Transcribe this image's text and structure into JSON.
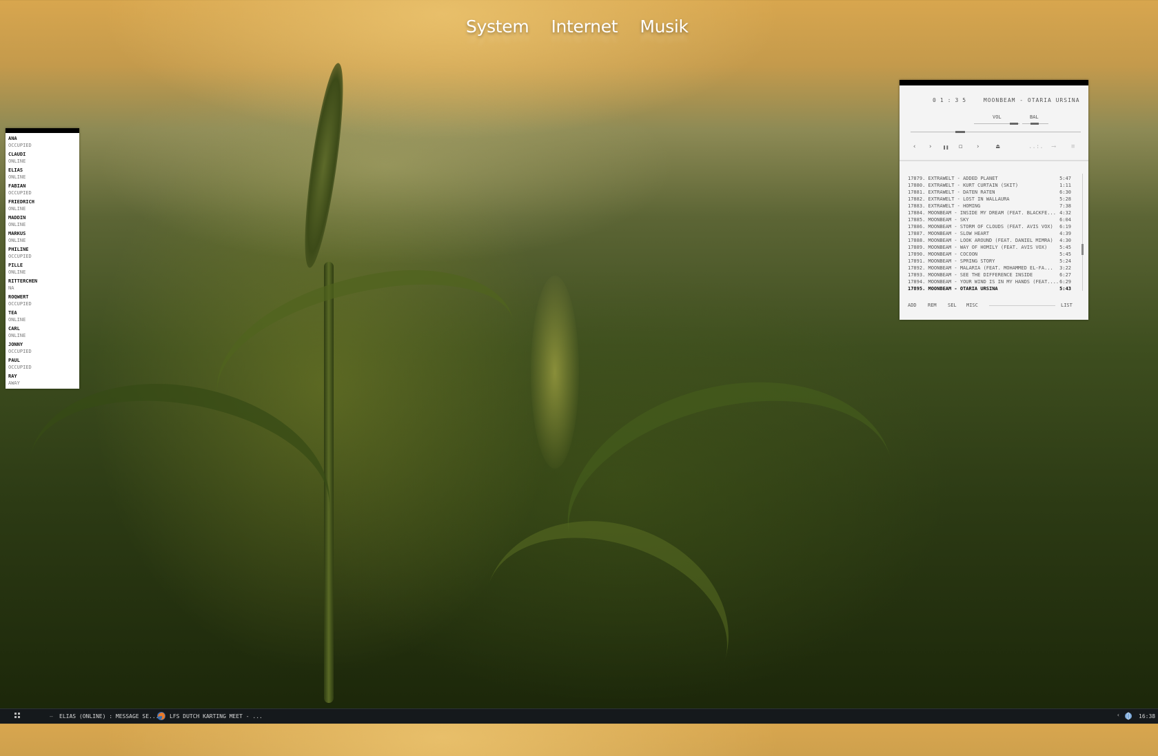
{
  "launcher": {
    "items": [
      "System",
      "Internet",
      "Musik"
    ]
  },
  "buddies": [
    {
      "name": "Ana",
      "status": "occupied"
    },
    {
      "name": "Claudi",
      "status": "online"
    },
    {
      "name": "Elias",
      "status": "online"
    },
    {
      "name": "Fabian",
      "status": "occupied"
    },
    {
      "name": "Friedrich",
      "status": "online"
    },
    {
      "name": "Maddin",
      "status": "online"
    },
    {
      "name": "Markus",
      "status": "online"
    },
    {
      "name": "Philine",
      "status": "occupied"
    },
    {
      "name": "Pille",
      "status": "online"
    },
    {
      "name": "Ritterchen",
      "status": "na"
    },
    {
      "name": "Roqwert",
      "status": "occupied"
    },
    {
      "name": "Tea",
      "status": "online"
    },
    {
      "name": "Carl",
      "status": "online"
    },
    {
      "name": "Jonny",
      "status": "occupied"
    },
    {
      "name": "Paul",
      "status": "occupied"
    },
    {
      "name": "Ray",
      "status": "away"
    }
  ],
  "player": {
    "time": "01:35",
    "now_playing": "Moonbeam - Otaria Ursina",
    "vol_label": "VOL",
    "bal_label": "BAL",
    "controls": {
      "prev": "‹",
      "next_small": "›",
      "pause": "❚❚",
      "stop": "◻",
      "play": "›",
      "eject": "⏏",
      "dots": "..:.",
      "arrow": "⟶",
      "menu": "≡"
    },
    "playlist": [
      {
        "title": "17879. Extrawelt - Added Planet",
        "length": "5:47"
      },
      {
        "title": "17880. Extrawelt - Kurt Curtain (Skit)",
        "length": "1:11"
      },
      {
        "title": "17881. Extrawelt - Daten Raten",
        "length": "6:30"
      },
      {
        "title": "17882. Extrawelt - Lost in Wallaura",
        "length": "5:28"
      },
      {
        "title": "17883. Extrawelt - Homing",
        "length": "7:38"
      },
      {
        "title": "17884. Moonbeam - Inside My Dream (Feat. Blackfe...",
        "length": "4:32"
      },
      {
        "title": "17885. Moonbeam - Sky",
        "length": "6:04"
      },
      {
        "title": "17886. Moonbeam - Storm of Clouds (Feat. Avis Vox)",
        "length": "6:19"
      },
      {
        "title": "17887. Moonbeam - Slow Heart",
        "length": "4:39"
      },
      {
        "title": "17888. Moonbeam - Look Around (Feat. Daniel Mimra)",
        "length": "4:30"
      },
      {
        "title": "17889. Moonbeam - Way of Homily (Feat. Avis Vox)",
        "length": "5:45"
      },
      {
        "title": "17890. Moonbeam - Cocoon",
        "length": "5:45"
      },
      {
        "title": "17891. Moonbeam - Spring Story",
        "length": "5:24"
      },
      {
        "title": "17892. Moonbeam - Malaria (Feat. Mohammed El-Fa...",
        "length": "3:22"
      },
      {
        "title": "17893. Moonbeam - See the Difference Inside",
        "length": "6:27"
      },
      {
        "title": "17894. Moonbeam - Your Wind Is In My Hands (Feat....",
        "length": "6:29"
      },
      {
        "title": "17895. Moonbeam - Otaria Ursina",
        "length": "5:43"
      }
    ],
    "footer": {
      "add": "ADD",
      "rem": "REM",
      "sel": "SEL",
      "misc": "MISC",
      "list": "LIST"
    }
  },
  "taskbar": {
    "task1": "Elias (online) : Message Se...",
    "task2": "LFS Dutch Karting Meet - ...",
    "clock": "16:38",
    "tray_arrow": "‹"
  }
}
